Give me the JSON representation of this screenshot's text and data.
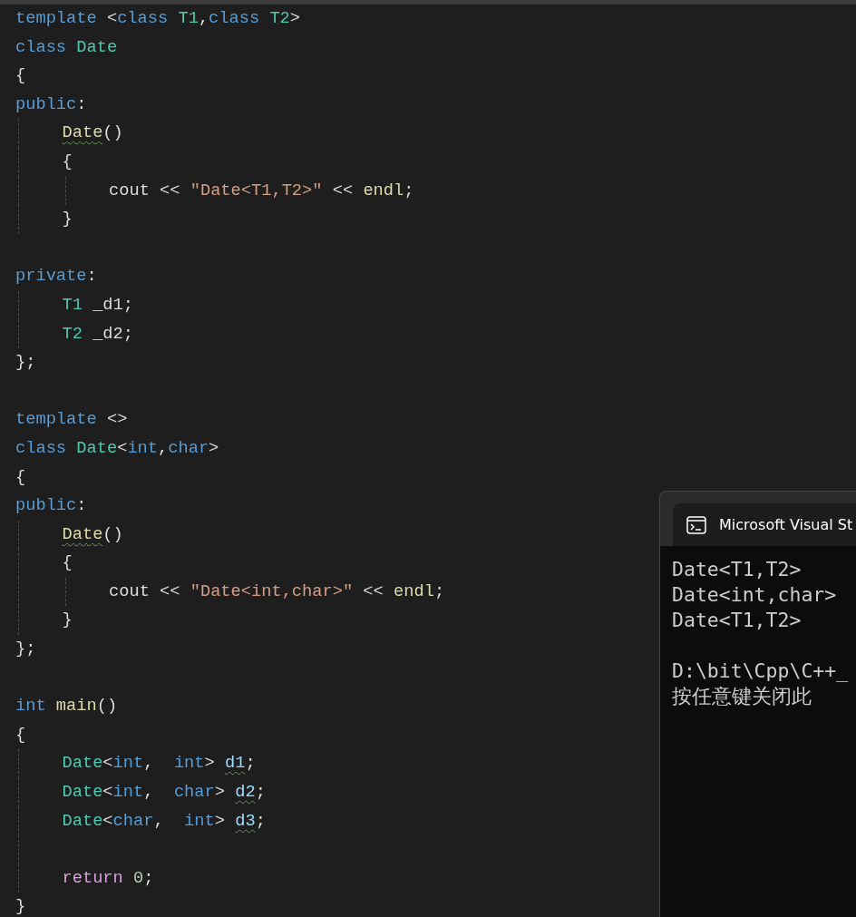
{
  "editor": {
    "lines": [
      {
        "kind": "code",
        "tokens": [
          {
            "kind": "keyword",
            "text": "template "
          },
          {
            "kind": "plain",
            "text": "<"
          },
          {
            "kind": "keyword",
            "text": "class "
          },
          {
            "kind": "type",
            "text": "T1"
          },
          {
            "kind": "plain",
            "text": ","
          },
          {
            "kind": "keyword",
            "text": "class "
          },
          {
            "kind": "type",
            "text": "T2"
          },
          {
            "kind": "plain",
            "text": ">"
          }
        ]
      },
      {
        "kind": "code",
        "tokens": [
          {
            "kind": "keyword",
            "text": "class "
          },
          {
            "kind": "type",
            "text": "Date"
          }
        ]
      },
      {
        "kind": "code",
        "tokens": [
          {
            "kind": "plain",
            "text": "{"
          }
        ]
      },
      {
        "kind": "code",
        "tokens": [
          {
            "kind": "keyword",
            "text": "public"
          },
          {
            "kind": "plain",
            "text": ":"
          }
        ]
      },
      {
        "kind": "code",
        "tokens": [
          {
            "kind": "function",
            "text": "\tDate",
            "squiggle": true
          },
          {
            "kind": "plain",
            "text": "()"
          }
        ]
      },
      {
        "kind": "code",
        "tokens": [
          {
            "kind": "plain",
            "text": "\t{"
          }
        ]
      },
      {
        "kind": "code",
        "tokens": [
          {
            "kind": "plain",
            "text": "\t\tcout << "
          },
          {
            "kind": "string",
            "text": "\"Date<T1,T2>\""
          },
          {
            "kind": "plain",
            "text": " << "
          },
          {
            "kind": "function",
            "text": "endl"
          },
          {
            "kind": "plain",
            "text": ";"
          }
        ]
      },
      {
        "kind": "code",
        "tokens": [
          {
            "kind": "plain",
            "text": "\t}"
          }
        ]
      },
      {
        "kind": "blank"
      },
      {
        "kind": "code",
        "tokens": [
          {
            "kind": "keyword",
            "text": "private"
          },
          {
            "kind": "plain",
            "text": ":"
          }
        ]
      },
      {
        "kind": "code",
        "tokens": [
          {
            "kind": "type",
            "text": "\tT1"
          },
          {
            "kind": "plain",
            "text": " _d1;"
          }
        ]
      },
      {
        "kind": "code",
        "tokens": [
          {
            "kind": "type",
            "text": "\tT2"
          },
          {
            "kind": "plain",
            "text": " _d2;"
          }
        ]
      },
      {
        "kind": "code",
        "tokens": [
          {
            "kind": "plain",
            "text": "};"
          }
        ]
      },
      {
        "kind": "blank"
      },
      {
        "kind": "code",
        "tokens": [
          {
            "kind": "keyword",
            "text": "template "
          },
          {
            "kind": "plain",
            "text": "<>"
          }
        ]
      },
      {
        "kind": "code",
        "tokens": [
          {
            "kind": "keyword",
            "text": "class "
          },
          {
            "kind": "type",
            "text": "Date"
          },
          {
            "kind": "plain",
            "text": "<"
          },
          {
            "kind": "keyword",
            "text": "int"
          },
          {
            "kind": "plain",
            "text": ","
          },
          {
            "kind": "keyword",
            "text": "char"
          },
          {
            "kind": "plain",
            "text": ">"
          }
        ]
      },
      {
        "kind": "code",
        "tokens": [
          {
            "kind": "plain",
            "text": "{"
          }
        ]
      },
      {
        "kind": "code",
        "tokens": [
          {
            "kind": "keyword",
            "text": "public"
          },
          {
            "kind": "plain",
            "text": ":"
          }
        ]
      },
      {
        "kind": "code",
        "tokens": [
          {
            "kind": "function",
            "text": "\tDate",
            "squiggle": true
          },
          {
            "kind": "plain",
            "text": "()"
          }
        ]
      },
      {
        "kind": "code",
        "tokens": [
          {
            "kind": "plain",
            "text": "\t{"
          }
        ]
      },
      {
        "kind": "code",
        "tokens": [
          {
            "kind": "plain",
            "text": "\t\tcout << "
          },
          {
            "kind": "string",
            "text": "\"Date<int,char>\""
          },
          {
            "kind": "plain",
            "text": " << "
          },
          {
            "kind": "function",
            "text": "endl"
          },
          {
            "kind": "plain",
            "text": ";"
          }
        ]
      },
      {
        "kind": "code",
        "tokens": [
          {
            "kind": "plain",
            "text": "\t}"
          }
        ]
      },
      {
        "kind": "code",
        "tokens": [
          {
            "kind": "plain",
            "text": "};"
          }
        ]
      },
      {
        "kind": "blank"
      },
      {
        "kind": "code",
        "tokens": [
          {
            "kind": "keyword",
            "text": "int "
          },
          {
            "kind": "function",
            "text": "main"
          },
          {
            "kind": "plain",
            "text": "()"
          }
        ]
      },
      {
        "kind": "code",
        "tokens": [
          {
            "kind": "plain",
            "text": "{"
          }
        ]
      },
      {
        "kind": "code",
        "tokens": [
          {
            "kind": "type",
            "text": "\tDate"
          },
          {
            "kind": "plain",
            "text": "<"
          },
          {
            "kind": "keyword",
            "text": "int"
          },
          {
            "kind": "plain",
            "text": ",  "
          },
          {
            "kind": "keyword",
            "text": "int"
          },
          {
            "kind": "plain",
            "text": "> "
          },
          {
            "kind": "variable",
            "text": "d1",
            "squiggle": true
          },
          {
            "kind": "plain",
            "text": ";"
          }
        ]
      },
      {
        "kind": "code",
        "tokens": [
          {
            "kind": "type",
            "text": "\tDate"
          },
          {
            "kind": "plain",
            "text": "<"
          },
          {
            "kind": "keyword",
            "text": "int"
          },
          {
            "kind": "plain",
            "text": ",  "
          },
          {
            "kind": "keyword",
            "text": "char"
          },
          {
            "kind": "plain",
            "text": "> "
          },
          {
            "kind": "variable",
            "text": "d2",
            "squiggle": true
          },
          {
            "kind": "plain",
            "text": ";"
          }
        ]
      },
      {
        "kind": "code",
        "tokens": [
          {
            "kind": "type",
            "text": "\tDate"
          },
          {
            "kind": "plain",
            "text": "<"
          },
          {
            "kind": "keyword",
            "text": "char"
          },
          {
            "kind": "plain",
            "text": ",  "
          },
          {
            "kind": "keyword",
            "text": "int"
          },
          {
            "kind": "plain",
            "text": "> "
          },
          {
            "kind": "variable",
            "text": "d3",
            "squiggle": true
          },
          {
            "kind": "plain",
            "text": ";"
          }
        ]
      },
      {
        "kind": "blank"
      },
      {
        "kind": "code",
        "tokens": [
          {
            "kind": "control",
            "text": "\treturn "
          },
          {
            "kind": "number",
            "text": "0"
          },
          {
            "kind": "plain",
            "text": ";"
          }
        ]
      },
      {
        "kind": "code",
        "tokens": [
          {
            "kind": "plain",
            "text": "}"
          }
        ]
      }
    ]
  },
  "console": {
    "title": "Microsoft Visual St",
    "lines": [
      {
        "kind": "text",
        "text": "Date<T1,T2>"
      },
      {
        "kind": "text",
        "text": "Date<int,char>"
      },
      {
        "kind": "text",
        "text": "Date<T1,T2>"
      },
      {
        "kind": "blank"
      },
      {
        "kind": "text",
        "text": "D:\\bit\\Cpp\\C++_"
      },
      {
        "kind": "text",
        "text": "按任意键关闭此"
      }
    ]
  }
}
